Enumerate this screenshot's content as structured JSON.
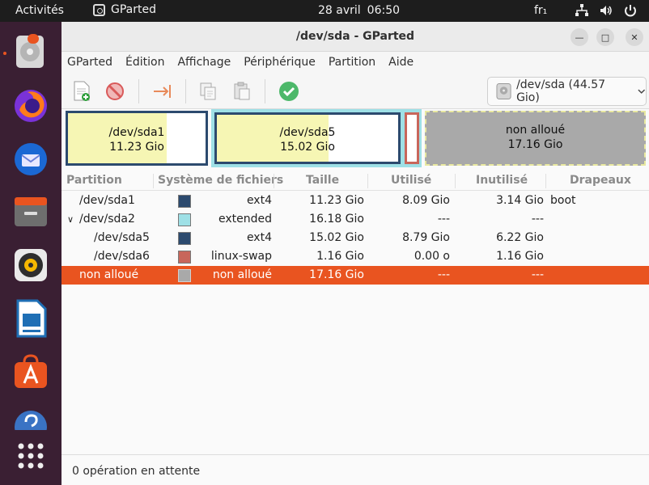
{
  "topbar": {
    "activities": "Activités",
    "app_name": "GParted",
    "date": "28 avril",
    "time": "06:50",
    "keyboard": "fr₁"
  },
  "window": {
    "title": "/dev/sda - GParted"
  },
  "menu": [
    "GParted",
    "Édition",
    "Affichage",
    "Périphérique",
    "Partition",
    "Aide"
  ],
  "device_selector": "/dev/sda (44.57 Gio)",
  "diskmap": {
    "sda1": {
      "name": "/dev/sda1",
      "size": "11.23 Gio"
    },
    "sda5": {
      "name": "/dev/sda5",
      "size": "15.02 Gio"
    },
    "unalloc": {
      "name": "non alloué",
      "size": "17.16 Gio"
    }
  },
  "columns": [
    "Partition",
    "Système de fichiers",
    "Taille",
    "Utilisé",
    "Inutilisé",
    "Drapeaux"
  ],
  "rows": [
    {
      "partition": "/dev/sda1",
      "fs": "ext4",
      "size": "11.23 Gio",
      "used": "8.09 Gio",
      "unused": "3.14 Gio",
      "flags": "boot",
      "color": "#2c4a6e"
    },
    {
      "partition": "/dev/sda2",
      "fs": "extended",
      "size": "16.18 Gio",
      "used": "---",
      "unused": "---",
      "flags": "",
      "color": "#9ee0e6"
    },
    {
      "partition": "/dev/sda5",
      "fs": "ext4",
      "size": "15.02 Gio",
      "used": "8.79 Gio",
      "unused": "6.22 Gio",
      "flags": "",
      "color": "#2c4a6e"
    },
    {
      "partition": "/dev/sda6",
      "fs": "linux-swap",
      "size": "1.16 Gio",
      "used": "0.00 o",
      "unused": "1.16 Gio",
      "flags": "",
      "color": "#c8665b"
    },
    {
      "partition": "non alloué",
      "fs": "non alloué",
      "size": "17.16 Gio",
      "used": "---",
      "unused": "---",
      "flags": "",
      "color": "#a9a9a9"
    }
  ],
  "status": "0 opération en attente",
  "colors": {
    "accent": "#e95420",
    "ext4": "#2c4a6e",
    "extended": "#9ee0e6",
    "swap": "#c8665b",
    "unallocated": "#a9a9a9"
  },
  "toolbar_icons": [
    "new-partition-icon",
    "delete-icon",
    "resize-move-icon",
    "copy-icon",
    "paste-icon",
    "apply-icon"
  ]
}
